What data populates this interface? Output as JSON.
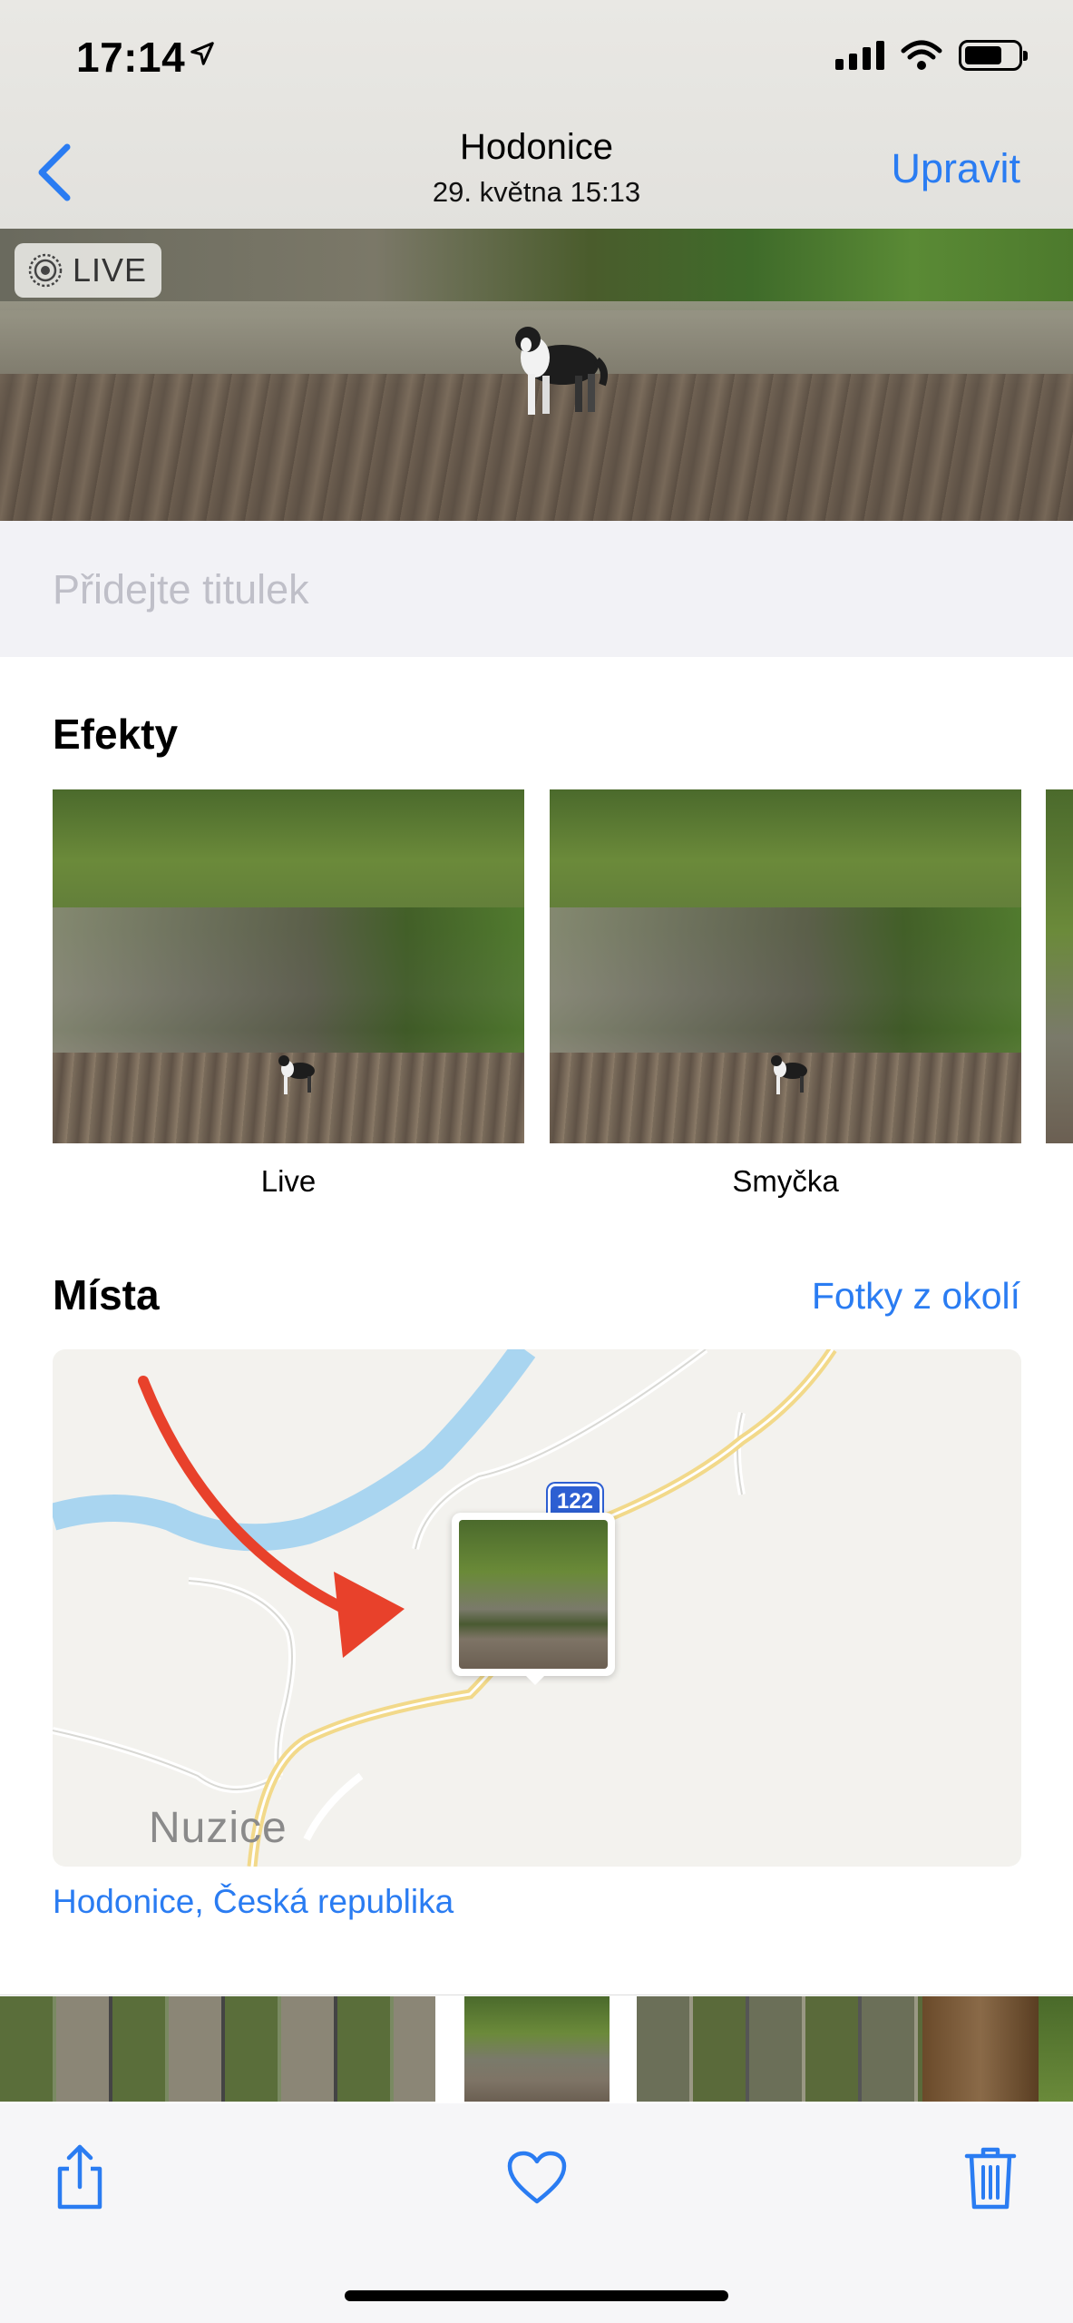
{
  "status_bar": {
    "time": "17:14"
  },
  "nav": {
    "title": "Hodonice",
    "subtitle": "29. května  15:13",
    "edit_label": "Upravit"
  },
  "photo": {
    "live_label": "LIVE"
  },
  "caption": {
    "placeholder": "Přidejte titulek"
  },
  "effects": {
    "title": "Efekty",
    "items": [
      {
        "label": "Live",
        "selected": true
      },
      {
        "label": "Smyčka",
        "selected": false
      }
    ]
  },
  "places": {
    "title": "Místa",
    "nearby_label": "Fotky z okolí",
    "map": {
      "road_number": "122",
      "town_label": "Nuzice"
    },
    "location_label": "Hodonice, Česká republika"
  },
  "colors": {
    "accent": "#2a7cf2",
    "selection": "#2f6fe6",
    "annotation_arrow": "#e8412b"
  },
  "toolbar": {
    "icons": [
      "share-icon",
      "heart-icon",
      "trash-icon"
    ]
  }
}
